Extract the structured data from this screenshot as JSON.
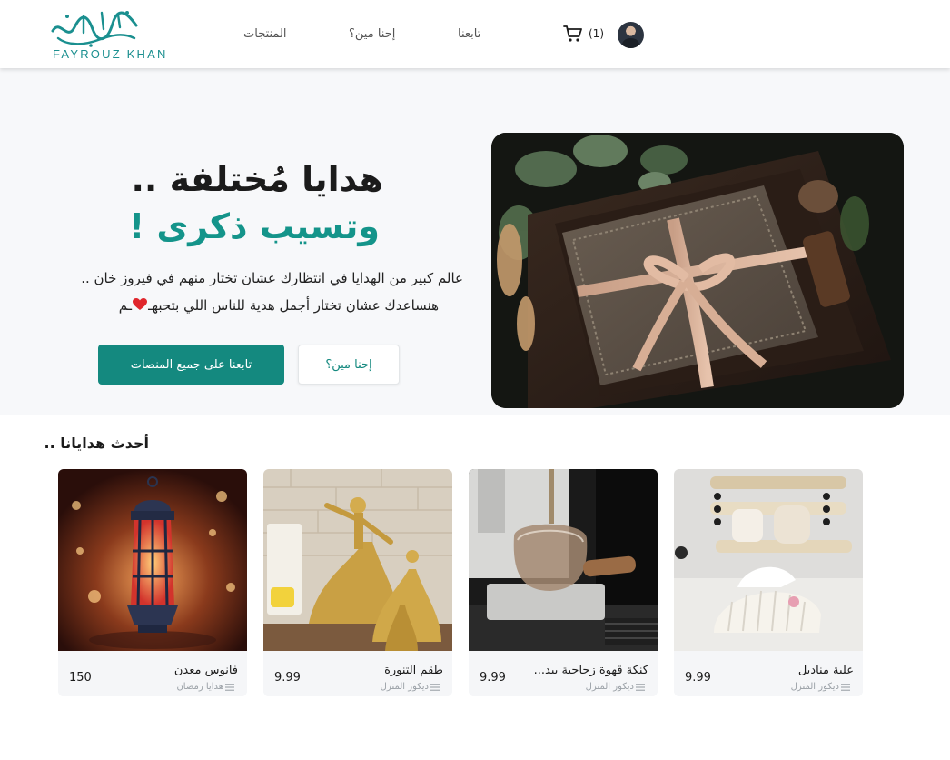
{
  "header": {
    "logo_text": "فيروز خان",
    "logo_sub": "FAYROUZ KHAN",
    "nav": {
      "products": "المنتجات",
      "about": "إحنا مين؟",
      "follow": "تابعنا"
    },
    "cart_count": "(1)"
  },
  "hero": {
    "line1": "هدايا مُختلفة ..",
    "line2": "وتسيب ذكرى !",
    "desc1": "عالم كبير من الهدايا في انتظارك عشان تختار منهم في فيروز خان ..",
    "desc2": "هنساعدك عشان تختار أجمل هدية للناس اللي بتحبهـ",
    "desc2_end": "ـم",
    "btn_follow": "تابعنا على جميع المنصات",
    "btn_about": "إحنا مين؟"
  },
  "section": {
    "title": "أحدث هدايانا .."
  },
  "products": [
    {
      "name": "علبة مناديل",
      "category": "ديكور المنزل",
      "price": "9.99"
    },
    {
      "name": "كنكة قهوة زجاجية بيد...",
      "category": "ديكور المنزل",
      "price": "9.99"
    },
    {
      "name": "طقم التنورة",
      "category": "ديكور المنزل",
      "price": "9.99"
    },
    {
      "name": "فانوس معدن",
      "category": "هدايا رمضان",
      "price": "150"
    }
  ],
  "colors": {
    "brand_teal": "#14897f",
    "hero_accent": "#14948a",
    "heart": "#e0262c"
  },
  "icons": [
    "cart-icon",
    "heart-icon",
    "list-icon"
  ]
}
